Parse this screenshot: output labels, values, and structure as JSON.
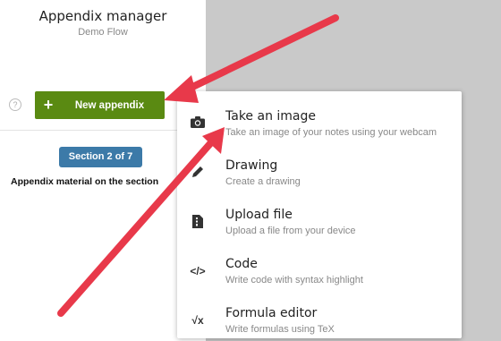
{
  "header": {
    "title": "Appendix manager",
    "subtitle": "Demo Flow"
  },
  "toolbar": {
    "help_glyph": "?",
    "plus_glyph": "+",
    "new_label": "New appendix"
  },
  "section": {
    "badge": "Section 2 of 7",
    "material": "Appendix material on the section"
  },
  "menu": {
    "items": [
      {
        "label": "Take an image",
        "desc": "Take an image of your notes using your webcam",
        "icon": "camera-icon"
      },
      {
        "label": "Drawing",
        "desc": "Create a drawing",
        "icon": "pencil-icon"
      },
      {
        "label": "Upload file",
        "desc": "Upload a file from your device",
        "icon": "file-icon"
      },
      {
        "label": "Code",
        "desc": "Write code with syntax highlight",
        "icon": "code-icon",
        "glyph": "</>"
      },
      {
        "label": "Formula editor",
        "desc": "Write formulas using TeX",
        "icon": "sqrt-icon",
        "glyph": "√x"
      }
    ]
  },
  "colors": {
    "button_green": "#5a8a12",
    "badge_blue": "#3c7aa8",
    "arrow_red": "#e8394a"
  }
}
